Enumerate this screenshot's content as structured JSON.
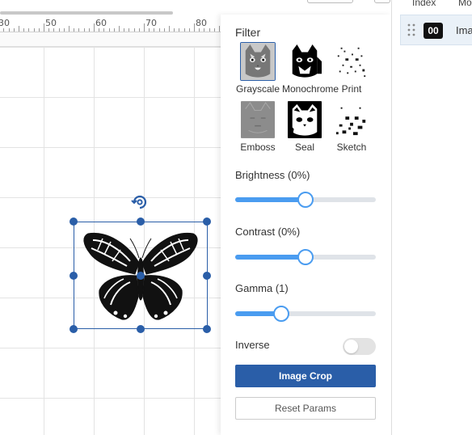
{
  "ruler": {
    "labels": [
      "30",
      "50",
      "60",
      "70",
      "80"
    ]
  },
  "filter": {
    "title": "Filter",
    "options": [
      {
        "label": "Grayscale",
        "active": true
      },
      {
        "label": "Monochrome",
        "active": false
      },
      {
        "label": "Print",
        "active": false
      },
      {
        "label": "Emboss",
        "active": false
      },
      {
        "label": "Seal",
        "active": false
      },
      {
        "label": "Sketch",
        "active": false
      }
    ]
  },
  "brightness": {
    "label": "Brightness (0%)",
    "value": 0.5
  },
  "contrast": {
    "label": "Contrast (0%)",
    "value": 0.5
  },
  "gamma": {
    "label": "Gamma (1)",
    "value": 0.33
  },
  "inverse": {
    "label": "Inverse",
    "on": false
  },
  "buttons": {
    "crop": "Image Crop",
    "reset": "Reset Params"
  },
  "layers": {
    "headers": [
      "Index",
      "Mo"
    ],
    "rows": [
      {
        "index": "00",
        "name": "Ima"
      }
    ]
  },
  "colors": {
    "accent": "#2a5ea8",
    "slider": "#4a9cf0"
  }
}
